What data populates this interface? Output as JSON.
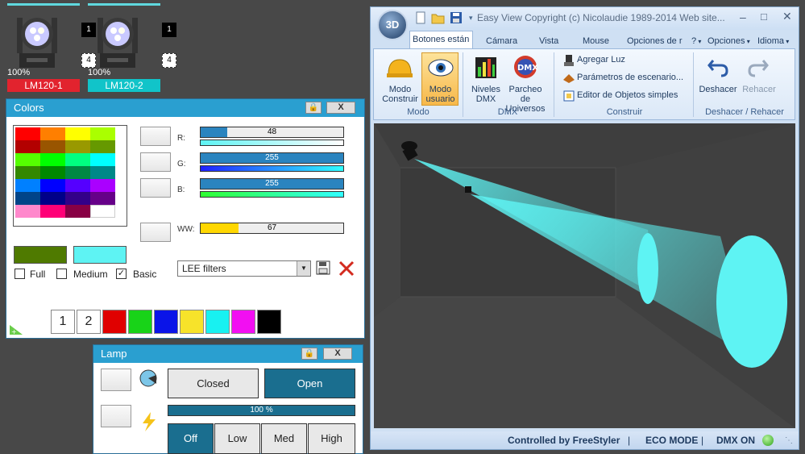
{
  "fixtures": [
    {
      "pct": "100%",
      "name": "LM120-1",
      "badge": "1",
      "badge2": "4",
      "color": "#e2232e"
    },
    {
      "pct": "100%",
      "name": "LM120-2",
      "badge": "1",
      "badge2": "4",
      "color": "#11c4c9"
    }
  ],
  "colors_panel": {
    "title": "Colors",
    "lock_icon": "lock-icon",
    "close_label": "X",
    "rgb": [
      {
        "label": "R:",
        "value": "48",
        "fill": 0.188
      },
      {
        "label": "G:",
        "value": "255",
        "fill": 1
      },
      {
        "label": "B:",
        "value": "255",
        "fill": 1
      }
    ],
    "ww": {
      "label": "WW:",
      "value": "67",
      "fill": 0.263
    },
    "options": [
      {
        "label": "Full",
        "checked": false
      },
      {
        "label": "Medium",
        "checked": false
      },
      {
        "label": "Basic",
        "checked": true
      }
    ],
    "filter_select": "LEE filters",
    "palette_pages": [
      "1",
      "2"
    ],
    "quick_colors": [
      "#e00000",
      "#18d318",
      "#0a14e8",
      "#f7e32a",
      "#18f1f1",
      "#f20ff2",
      "#000000"
    ],
    "swatch_current": "#4f7a00",
    "swatch_target": "#5ef3f3"
  },
  "lamp_panel": {
    "title": "Lamp",
    "close_label": "X",
    "closed_label": "Closed",
    "open_label": "Open",
    "dimmer": "100 %",
    "levels": [
      "Off",
      "Low",
      "Med",
      "High"
    ]
  },
  "window": {
    "title": "Easy View  Copyright (c) Nicolaudie 1989-2014  Web site...",
    "logo": "3D",
    "tabs": [
      "Botones están",
      "Cámara",
      "Vista",
      "Mouse",
      "Opciones de r"
    ],
    "right_menu": [
      "?",
      "Opciones",
      "Idioma"
    ],
    "modo": {
      "group": "Modo",
      "buttons": [
        {
          "label": "Modo Construir"
        },
        {
          "label": "Modo usuario"
        }
      ]
    },
    "dmx": {
      "group": "DMX",
      "buttons": [
        {
          "label": "Niveles DMX"
        },
        {
          "label": "Parcheo de Universos"
        }
      ]
    },
    "construir": {
      "group": "Construir",
      "items": [
        "Agregar Luz",
        "Parámetros de escenario...",
        "Editor de Objetos simples"
      ]
    },
    "undo": {
      "group": "Deshacer / Rehacer",
      "buttons": [
        "Deshacer",
        "Rehacer"
      ]
    },
    "status": [
      "Controlled by FreeStyler",
      "ECO MODE",
      "DMX ON"
    ]
  }
}
